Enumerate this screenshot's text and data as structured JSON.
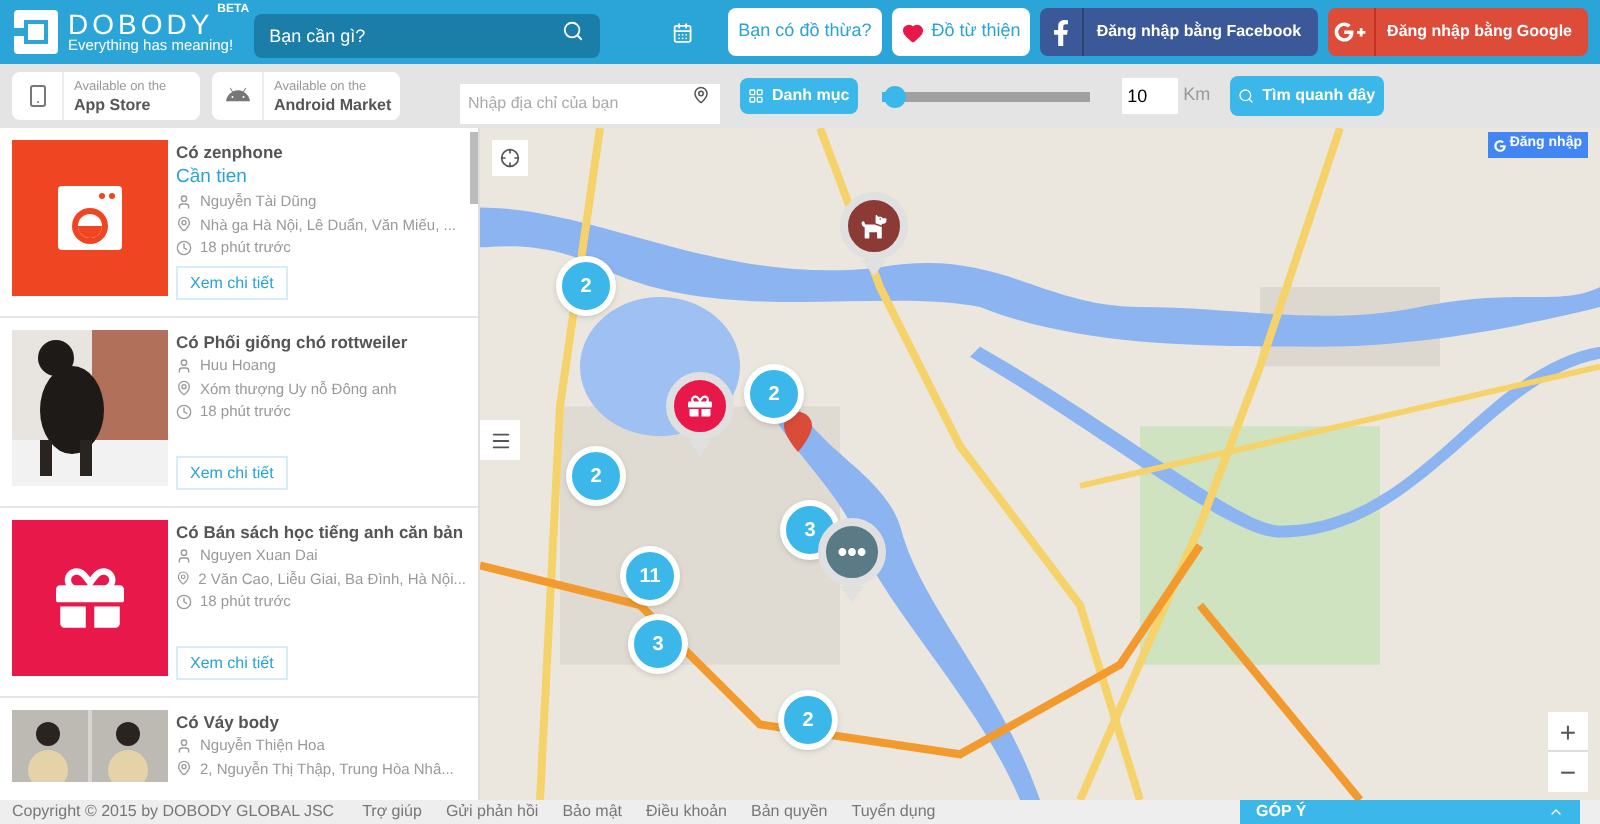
{
  "header": {
    "logo": "DOBODY",
    "beta": "BETA",
    "tagline": "Everything has meaning!",
    "search": {
      "placeholder": "Bạn cần gì?"
    },
    "buttons": [
      {
        "kind": "plain",
        "label": "Bạn có đồ thừa?"
      },
      {
        "kind": "heart",
        "label": "Đồ từ thiện"
      },
      {
        "kind": "facebook",
        "label": "Đăng nhập bằng Facebook"
      },
      {
        "kind": "google",
        "label": "Đăng nhập bằng Google"
      }
    ]
  },
  "toolbar": {
    "stores": [
      {
        "kind": "apple",
        "small": "Available on the",
        "name": "App Store"
      },
      {
        "kind": "android",
        "small": "Available on the",
        "name": "Android Market"
      }
    ],
    "address": {
      "placeholder": "Nhập địa chỉ của bạn"
    },
    "category": "Danh mục",
    "radius": {
      "level": 0.06
    },
    "distance": "10",
    "unit": "Km",
    "search_nearby": "Tìm quanh đây"
  },
  "listings": [
    {
      "kind": "washer",
      "title": "Có zenphone",
      "tag": "Cần tien",
      "user": "Nguyễn Tài Dũng",
      "address": "Nhà ga Hà Nội, Lê Duẩn, Văn Miếu, ...",
      "time": "18 phút trước",
      "action": "Xem chi tiết"
    },
    {
      "kind": "dog",
      "title": "Có Phối giống chó rottweiler",
      "user": "Huu Hoang",
      "address": "Xóm thượng Uy nỗ Đông anh",
      "time": "18 phút trước",
      "action": "Xem chi tiết"
    },
    {
      "kind": "gift",
      "title": "Có Bán sách học tiếng anh căn bản",
      "user": "Nguyen Xuan Dai",
      "address": "2 Văn Cao, Liễu Giai, Ba Đình, Hà Nội...",
      "time": "18 phút trước",
      "action": "Xem chi tiết"
    },
    {
      "kind": "clothes",
      "title": "Có Váy body",
      "user": "Nguyễn Thiện Hoa",
      "address": "2, Nguyễn Thị Thập, Trung Hòa Nhâ..."
    }
  ],
  "map": {
    "login": "Đăng nhập",
    "zoom_in": "+",
    "zoom_out": "−",
    "clusters": [
      {
        "count": "2"
      },
      {
        "count": "2"
      },
      {
        "count": "2"
      },
      {
        "count": "11"
      },
      {
        "count": "3"
      },
      {
        "count": "3"
      },
      {
        "count": "2"
      }
    ],
    "pins": [
      {
        "kind": "dog",
        "color": "#8b3a36"
      },
      {
        "kind": "gift",
        "color": "#e8184a"
      },
      {
        "kind": "more",
        "color": "#5a7a86"
      }
    ]
  },
  "footer": {
    "copyright": "Copyright © 2015 by DOBODY GLOBAL JSC",
    "links": [
      "Trợ giúp",
      "Gửi phản hồi",
      "Bảo mật",
      "Điều khoản",
      "Bản quyền",
      "Tuyển dụng"
    ],
    "feedback": "GÓP Ý"
  }
}
